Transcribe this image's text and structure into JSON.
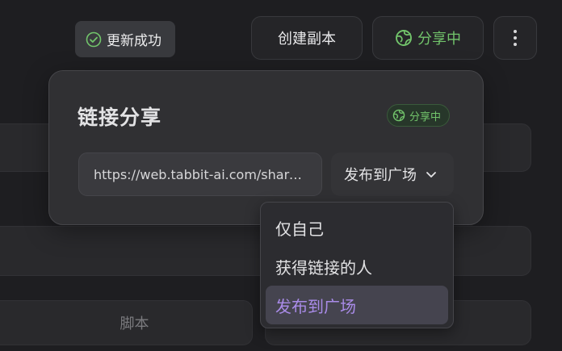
{
  "toolbar": {
    "toast_label": "更新成功",
    "copy_button_label": "创建副本",
    "share_button_label": "分享中"
  },
  "background": {
    "card_label": "脚本"
  },
  "share_panel": {
    "title": "链接分享",
    "badge_label": "分享中",
    "url_value": "https://web.tabbit-ai.com/share...",
    "scope_selected": "发布到广场"
  },
  "dropdown": {
    "options": [
      {
        "label": "仅自己"
      },
      {
        "label": "获得链接的人"
      },
      {
        "label": "发布到广场"
      }
    ],
    "selected_index": 2
  },
  "colors": {
    "accent_green": "#72c46b",
    "accent_purple": "#a98be8",
    "background": "#1e1e21"
  },
  "icons": {
    "toast": "check-circle-icon",
    "share": "globe-icon",
    "more": "more-vertical-icon",
    "scope": "chevron-down-icon"
  }
}
